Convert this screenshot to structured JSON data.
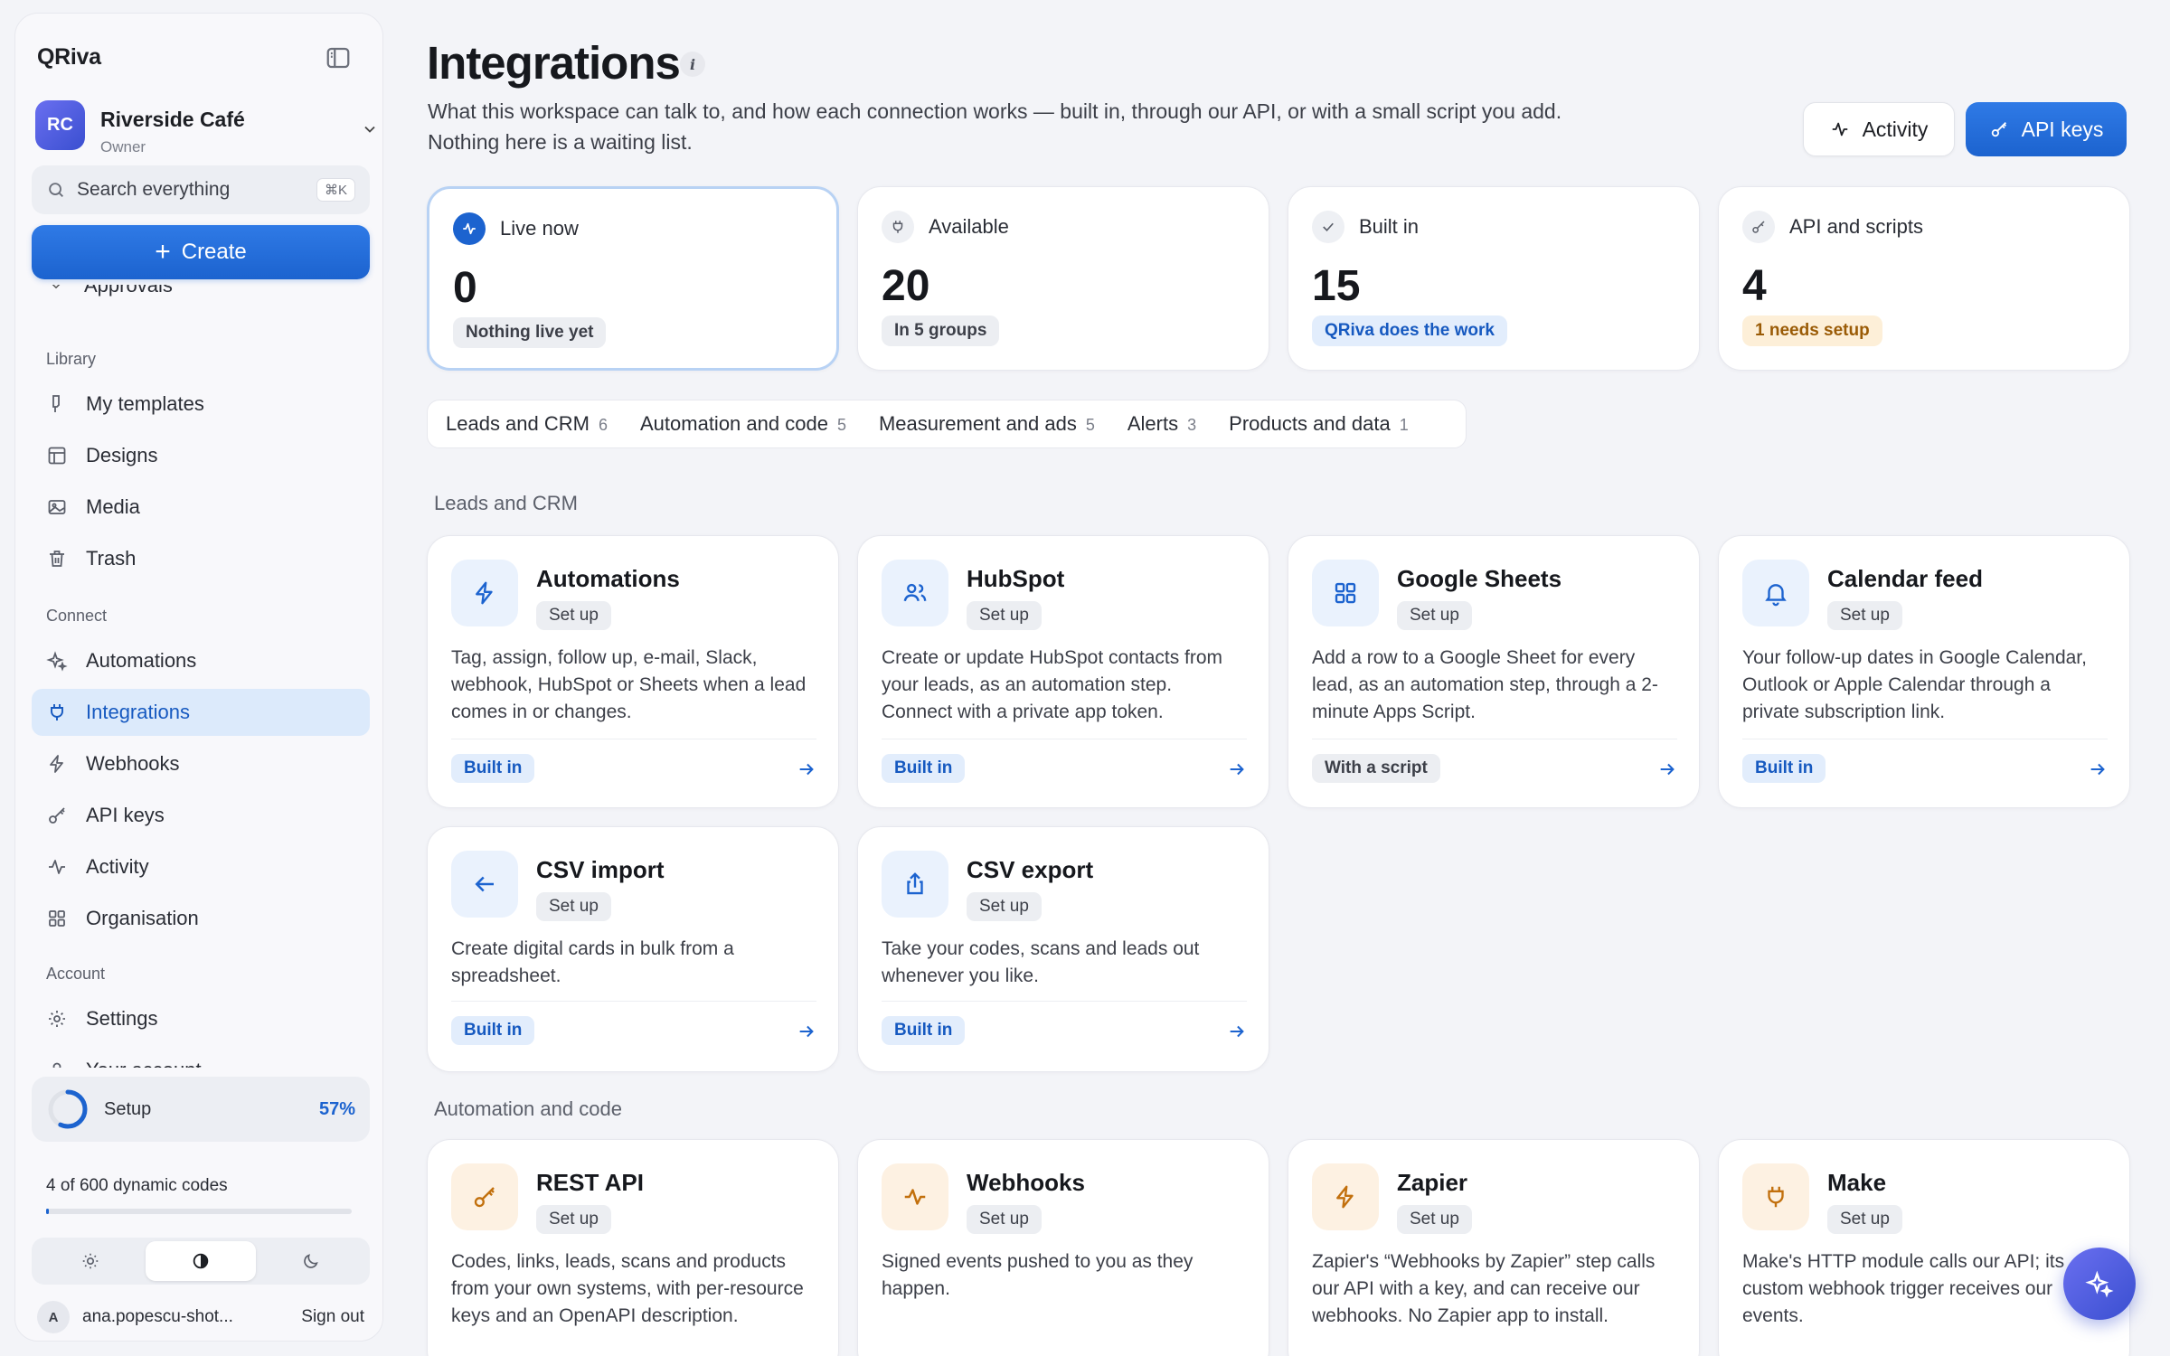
{
  "app": {
    "brand": "QRiva",
    "workspace": {
      "initials": "RC",
      "name": "Riverside Café",
      "role": "Owner"
    }
  },
  "search": {
    "placeholder": "Search everything",
    "shortcut": "⌘K"
  },
  "create_label": "Create",
  "nav": {
    "cut_item": "Approvals",
    "sections": [
      {
        "label": "Library",
        "items": [
          {
            "label": "My templates",
            "icon": "brush-icon"
          },
          {
            "label": "Designs",
            "icon": "layout-icon"
          },
          {
            "label": "Media",
            "icon": "image-icon"
          },
          {
            "label": "Trash",
            "icon": "trash-icon"
          }
        ]
      },
      {
        "label": "Connect",
        "items": [
          {
            "label": "Automations",
            "icon": "sparkle-icon"
          },
          {
            "label": "Integrations",
            "icon": "plug-icon",
            "active": true
          },
          {
            "label": "Webhooks",
            "icon": "bolt-icon"
          },
          {
            "label": "API keys",
            "icon": "key-icon"
          },
          {
            "label": "Activity",
            "icon": "pulse-icon"
          },
          {
            "label": "Organisation",
            "icon": "grid-icon"
          }
        ]
      },
      {
        "label": "Account",
        "items": [
          {
            "label": "Settings",
            "icon": "gear-icon"
          },
          {
            "label": "Your account",
            "icon": "user-icon"
          }
        ]
      }
    ]
  },
  "setup": {
    "label": "Setup",
    "percent_text": "57%",
    "progress": 0.57
  },
  "codes": {
    "text": "4 of 600 dynamic codes",
    "progress": 0.0067
  },
  "theme": {
    "options": [
      "light",
      "system",
      "dark"
    ],
    "selected": "system"
  },
  "user": {
    "initial": "A",
    "email": "ana.popescu-shot...",
    "signout": "Sign out"
  },
  "page": {
    "title": "Integrations",
    "info": "i",
    "subtitle": "What this workspace can talk to, and how each connection works — built in, through our API, or with a small script you add. Nothing here is a waiting list.",
    "activity_label": "Activity",
    "api_keys_label": "API keys"
  },
  "stats": [
    {
      "label": "Live now",
      "value": "0",
      "badge": "Nothing live yet",
      "icon": "pulse-icon",
      "tone": "gray",
      "highlight": true
    },
    {
      "label": "Available",
      "value": "20",
      "badge": "In 5 groups",
      "icon": "plug-icon",
      "tone": "gray"
    },
    {
      "label": "Built in",
      "value": "15",
      "badge": "QRiva does the work",
      "icon": "check-icon",
      "tone": "blue"
    },
    {
      "label": "API and scripts",
      "value": "4",
      "badge": "1 needs setup",
      "icon": "key-icon",
      "tone": "amber"
    }
  ],
  "tabs": [
    {
      "label": "Leads and CRM",
      "count": "6"
    },
    {
      "label": "Automation and code",
      "count": "5"
    },
    {
      "label": "Measurement and ads",
      "count": "5"
    },
    {
      "label": "Alerts",
      "count": "3"
    },
    {
      "label": "Products and data",
      "count": "1"
    }
  ],
  "groups": [
    {
      "label": "Leads and CRM",
      "cards": [
        {
          "title": "Automations",
          "setup": "Set up",
          "desc": "Tag, assign, follow up, e-mail, Slack, webhook, HubSpot or Sheets when a lead comes in or changes.",
          "tag": "Built in",
          "tag_tone": "blue",
          "icon": "bolt-icon",
          "tone": "blue"
        },
        {
          "title": "HubSpot",
          "setup": "Set up",
          "desc": "Create or update HubSpot contacts from your leads, as an automation step. Connect with a private app token.",
          "tag": "Built in",
          "tag_tone": "blue",
          "icon": "users-icon",
          "tone": "blue"
        },
        {
          "title": "Google Sheets",
          "setup": "Set up",
          "desc": "Add a row to a Google Sheet for every lead, as an automation step, through a 2-minute Apps Script.",
          "tag": "With a script",
          "tag_tone": "gray",
          "icon": "grid-icon",
          "tone": "blue"
        },
        {
          "title": "Calendar feed",
          "setup": "Set up",
          "desc": "Your follow-up dates in Google Calendar, Outlook or Apple Calendar through a private subscription link.",
          "tag": "Built in",
          "tag_tone": "blue",
          "icon": "bell-icon",
          "tone": "blue"
        },
        {
          "title": "CSV import",
          "setup": "Set up",
          "desc": "Create digital cards in bulk from a spreadsheet.",
          "tag": "Built in",
          "tag_tone": "blue",
          "icon": "arrow-left-icon",
          "tone": "blue"
        },
        {
          "title": "CSV export",
          "setup": "Set up",
          "desc": "Take your codes, scans and leads out whenever you like.",
          "tag": "Built in",
          "tag_tone": "blue",
          "icon": "share-icon",
          "tone": "blue"
        }
      ]
    },
    {
      "label": "Automation and code",
      "cards": [
        {
          "title": "REST API",
          "setup": "Set up",
          "desc": "Codes, links, leads, scans and products from your own systems, with per-resource keys and an OpenAPI description.",
          "icon": "key-icon",
          "tone": "amber"
        },
        {
          "title": "Webhooks",
          "setup": "Set up",
          "desc": "Signed events pushed to you as they happen.",
          "icon": "pulse-icon",
          "tone": "amber"
        },
        {
          "title": "Zapier",
          "setup": "Set up",
          "desc": "Zapier's “Webhooks by Zapier” step calls our API with a key, and can receive our webhooks. No Zapier app to install.",
          "icon": "bolt-icon",
          "tone": "amber"
        },
        {
          "title": "Make",
          "setup": "Set up",
          "desc": "Make's HTTP module calls our API; its custom webhook trigger receives our events.",
          "icon": "plug-icon",
          "tone": "amber"
        }
      ]
    }
  ],
  "colors": {
    "accent": "#1c63cf",
    "amber": "#c2700d",
    "active_bg": "#dceafb"
  }
}
